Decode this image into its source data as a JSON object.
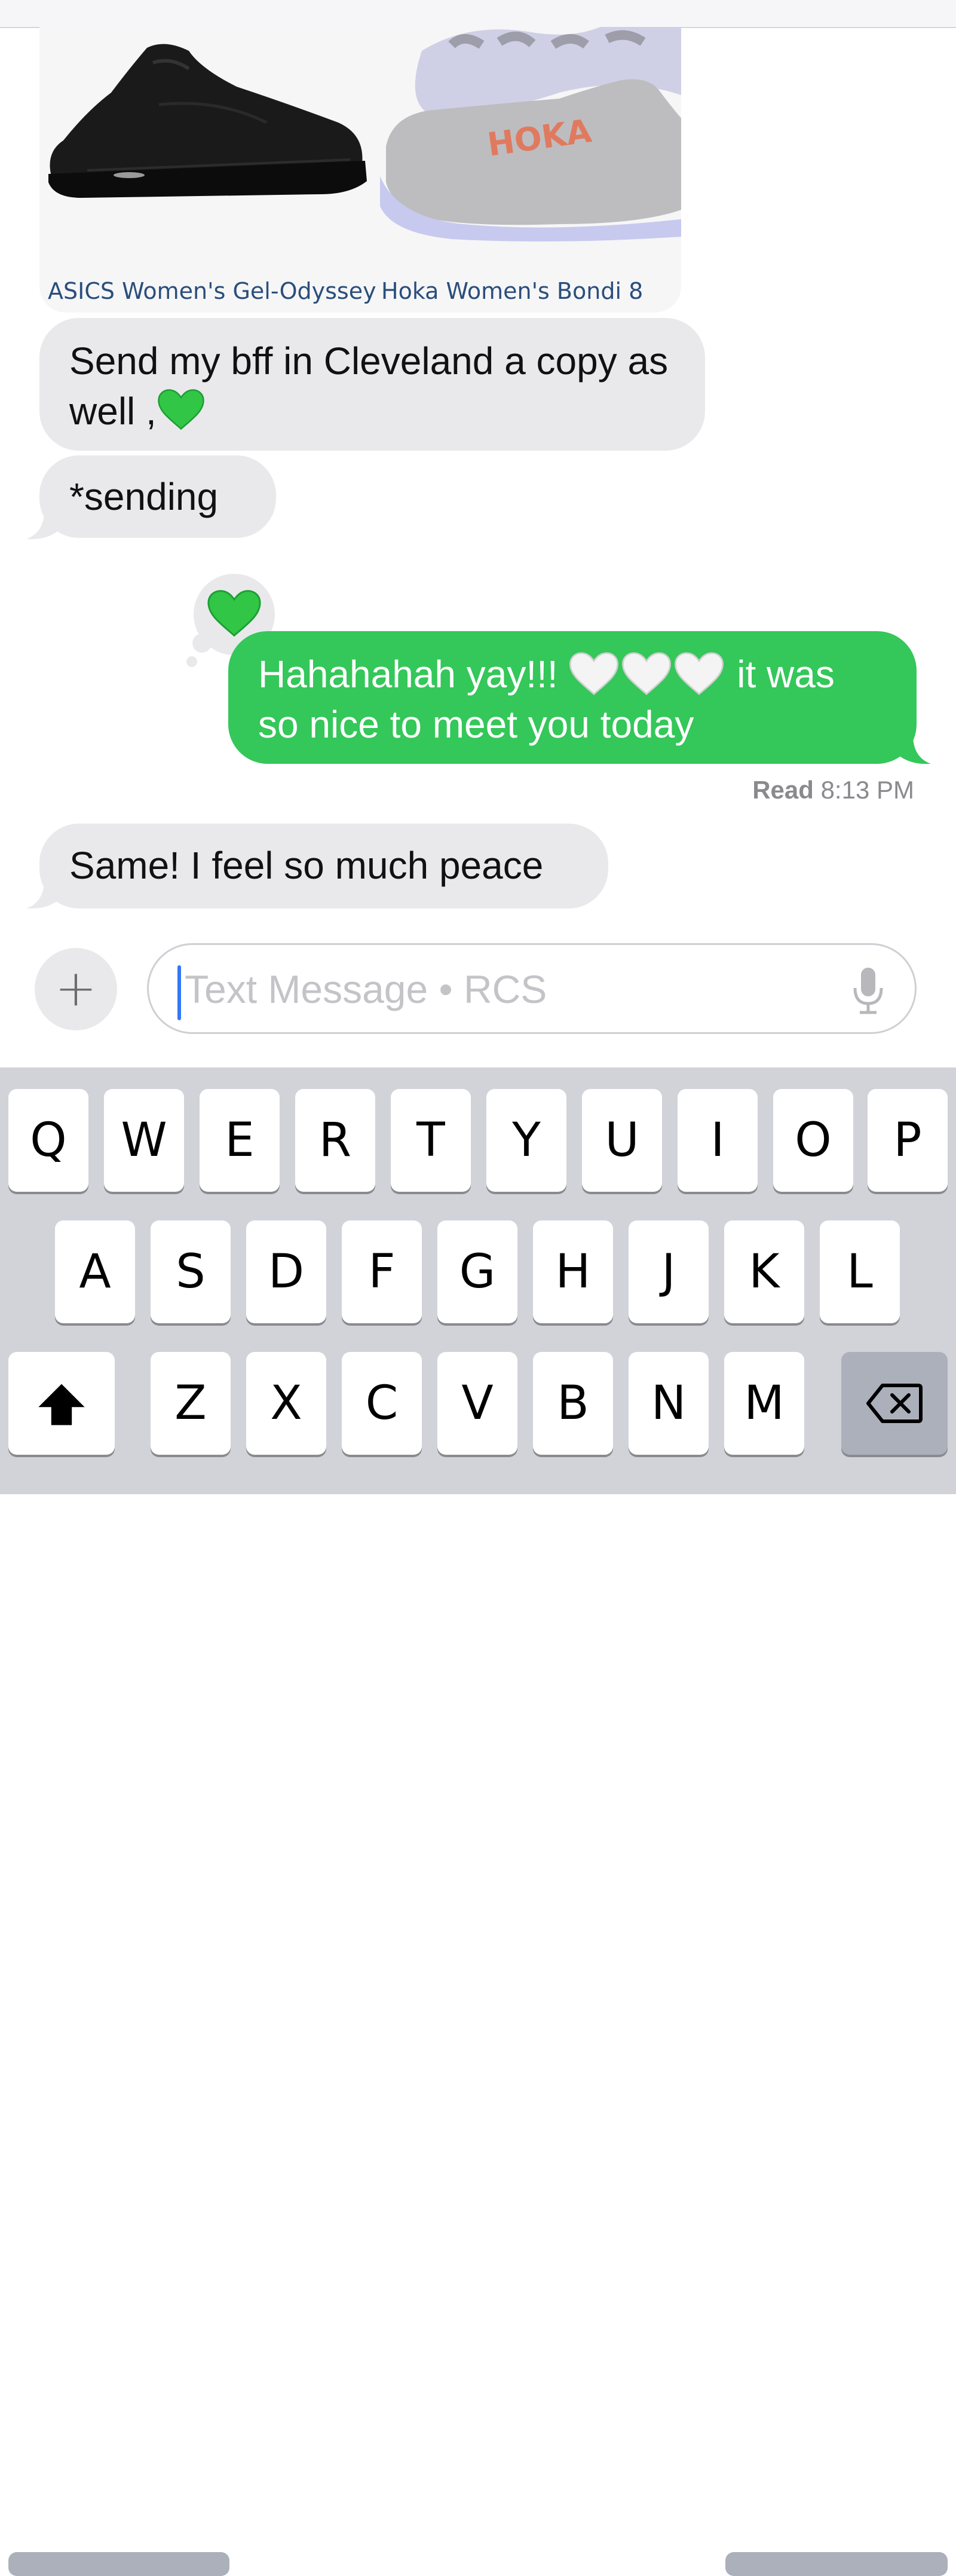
{
  "link_preview": {
    "items": [
      {
        "caption": "ASICS Women's Gel-Odyssey",
        "image": "black-sneaker"
      },
      {
        "caption": "Hoka Women's Bondi 8",
        "image": "gray-hoka-sneaker",
        "brand_mark": "HOKA"
      }
    ]
  },
  "messages": [
    {
      "direction": "incoming",
      "text": "Send my bff in Cleveland a copy as well ,",
      "emoji": "green-heart"
    },
    {
      "direction": "incoming",
      "text": "*sending"
    },
    {
      "direction": "outgoing",
      "text_part1": "Hahahahah yay!!!",
      "emoji": "white-heart x3",
      "text_part2": "it was so nice to meet you today",
      "tapback": "green-heart"
    },
    {
      "direction": "incoming",
      "text": "Same! I feel so much peace"
    }
  ],
  "receipt": {
    "status": "Read",
    "time": "8:13 PM"
  },
  "composer": {
    "plus": "+",
    "placeholder": "Text Message • RCS",
    "mic_icon": "mic-icon"
  },
  "keyboard": {
    "row1": [
      "Q",
      "W",
      "E",
      "R",
      "T",
      "Y",
      "U",
      "I",
      "O",
      "P"
    ],
    "row2": [
      "A",
      "S",
      "D",
      "F",
      "G",
      "H",
      "J",
      "K",
      "L"
    ],
    "row3": [
      "Z",
      "X",
      "C",
      "V",
      "B",
      "N",
      "M"
    ]
  },
  "colors": {
    "outgoing": "#34c759",
    "incoming": "#e9e9eb",
    "keyboard_bg": "#d1d3d9",
    "caret": "#3478f6"
  }
}
